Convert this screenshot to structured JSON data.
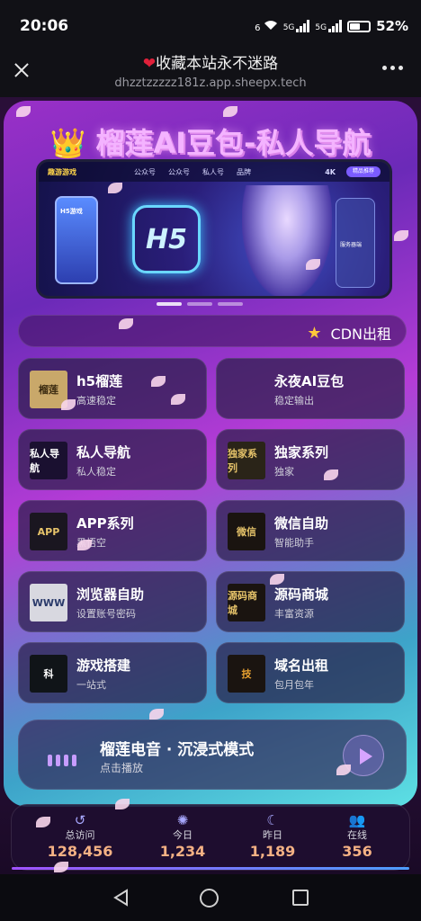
{
  "status": {
    "time": "20:06",
    "net1": "6",
    "net2": "5G",
    "net3": "5G",
    "battery": "52%"
  },
  "browser": {
    "title": "收藏本站永不迷路",
    "url": "dhzztzzzzz181z.app.sheepx.tech"
  },
  "site": {
    "title": "榴莲AI豆包-私人导航",
    "cdn_label": "CDN出租"
  },
  "banner": {
    "logo": "趣游游戏",
    "nav": [
      "公众号",
      "公众号",
      "私人号",
      "品牌"
    ],
    "badge": "4K",
    "button": "精品推荐",
    "phone_text": "H5游戏",
    "h5_text": "H5",
    "side_label": "服务器端"
  },
  "tiles": [
    {
      "title": "h5榴莲",
      "subtitle": "高速稳定",
      "icon": "durian-icon",
      "img_text": "榴莲",
      "img_bg": "#c9a86a",
      "img_fg": "#3a2a10"
    },
    {
      "title": "永夜AI豆包",
      "subtitle": "稳定输出",
      "icon": "",
      "img_text": "",
      "img_bg": "",
      "img_fg": ""
    },
    {
      "title": "私人导航",
      "subtitle": "私人稳定",
      "icon": "private-nav-icon",
      "img_text": "私人导航",
      "img_bg": "#1a1030",
      "img_fg": "#ffffff"
    },
    {
      "title": "独家系列",
      "subtitle": "独家",
      "icon": "exclusive-icon",
      "img_text": "独家系列",
      "img_bg": "#2a2418",
      "img_fg": "#e6c36a"
    },
    {
      "title": "APP系列",
      "subtitle": "黑悟空",
      "icon": "app-wings-icon",
      "img_text": "APP",
      "img_bg": "#1a1620",
      "img_fg": "#e6c36a"
    },
    {
      "title": "微信自助",
      "subtitle": "智能助手",
      "icon": "wechat-icon",
      "img_text": "微信",
      "img_bg": "#1a1410",
      "img_fg": "#e6c36a"
    },
    {
      "title": "浏览器自助",
      "subtitle": "设置账号密码",
      "icon": "browser-www-icon",
      "img_text": "WWW",
      "img_bg": "#d8d8e0",
      "img_fg": "#2a3a6a"
    },
    {
      "title": "源码商城",
      "subtitle": "丰富资源",
      "icon": "source-shop-icon",
      "img_text": "源码商城",
      "img_bg": "#1a1410",
      "img_fg": "#e6c36a"
    },
    {
      "title": "游戏搭建",
      "subtitle": "一站式",
      "icon": "game-ke-icon",
      "img_text": "科",
      "img_bg": "#101418",
      "img_fg": "#ffffff"
    },
    {
      "title": "域名出租",
      "subtitle": "包月包年",
      "icon": "domain-ji-icon",
      "img_text": "技",
      "img_bg": "#1a1410",
      "img_fg": "#e6a030"
    }
  ],
  "music": {
    "title": "榴莲电音 · 沉浸式模式",
    "subtitle": "点击播放"
  },
  "stats": [
    {
      "label": "总访问",
      "value": "128,456",
      "icon": "history-icon"
    },
    {
      "label": "今日",
      "value": "1,234",
      "icon": "sun-icon"
    },
    {
      "label": "昨日",
      "value": "1,189",
      "icon": "moon-icon"
    },
    {
      "label": "在线",
      "value": "356",
      "icon": "users-icon"
    }
  ],
  "colors": {
    "title": "#f4b3ff",
    "stat_value": "#f4b184",
    "accent": "#b43cd6"
  }
}
